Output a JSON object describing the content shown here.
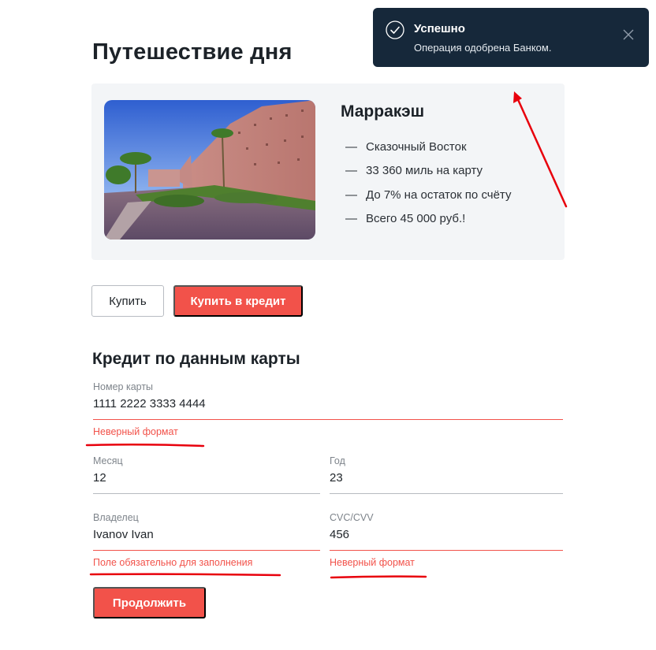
{
  "page": {
    "title": "Путешествие дня"
  },
  "offer": {
    "city": "Марракэш",
    "features": [
      {
        "dash": "—",
        "text": "Сказочный Восток"
      },
      {
        "dash": "—",
        "text": "33 360 миль на карту"
      },
      {
        "dash": "—",
        "text": "До 7% на остаток по счёту"
      },
      {
        "dash": "—",
        "text": "Всего 45 000 руб.!"
      }
    ]
  },
  "actions": {
    "buy": "Купить",
    "buy_credit": "Купить в кредит"
  },
  "form": {
    "title": "Кредит по данным карты",
    "card_number": {
      "label": "Номер карты",
      "value": "1111 2222 3333 4444",
      "error": "Неверный формат"
    },
    "month": {
      "label": "Месяц",
      "value": "12"
    },
    "year": {
      "label": "Год",
      "value": "23"
    },
    "owner": {
      "label": "Владелец",
      "value": "Ivanov Ivan",
      "error": "Поле обязательно для заполнения"
    },
    "cvc": {
      "label": "CVC/CVV",
      "value": "456",
      "error": "Неверный формат"
    },
    "continue": "Продолжить"
  },
  "toast": {
    "title": "Успешно",
    "message": "Операция одобрена Банком."
  },
  "colors": {
    "accent": "#f2524a",
    "toast_bg": "#16283a",
    "card_bg": "#f3f5f7",
    "annotation": "#e8000c"
  },
  "icons": {
    "toast_status": "check-circle-icon",
    "toast_close": "close-icon"
  }
}
